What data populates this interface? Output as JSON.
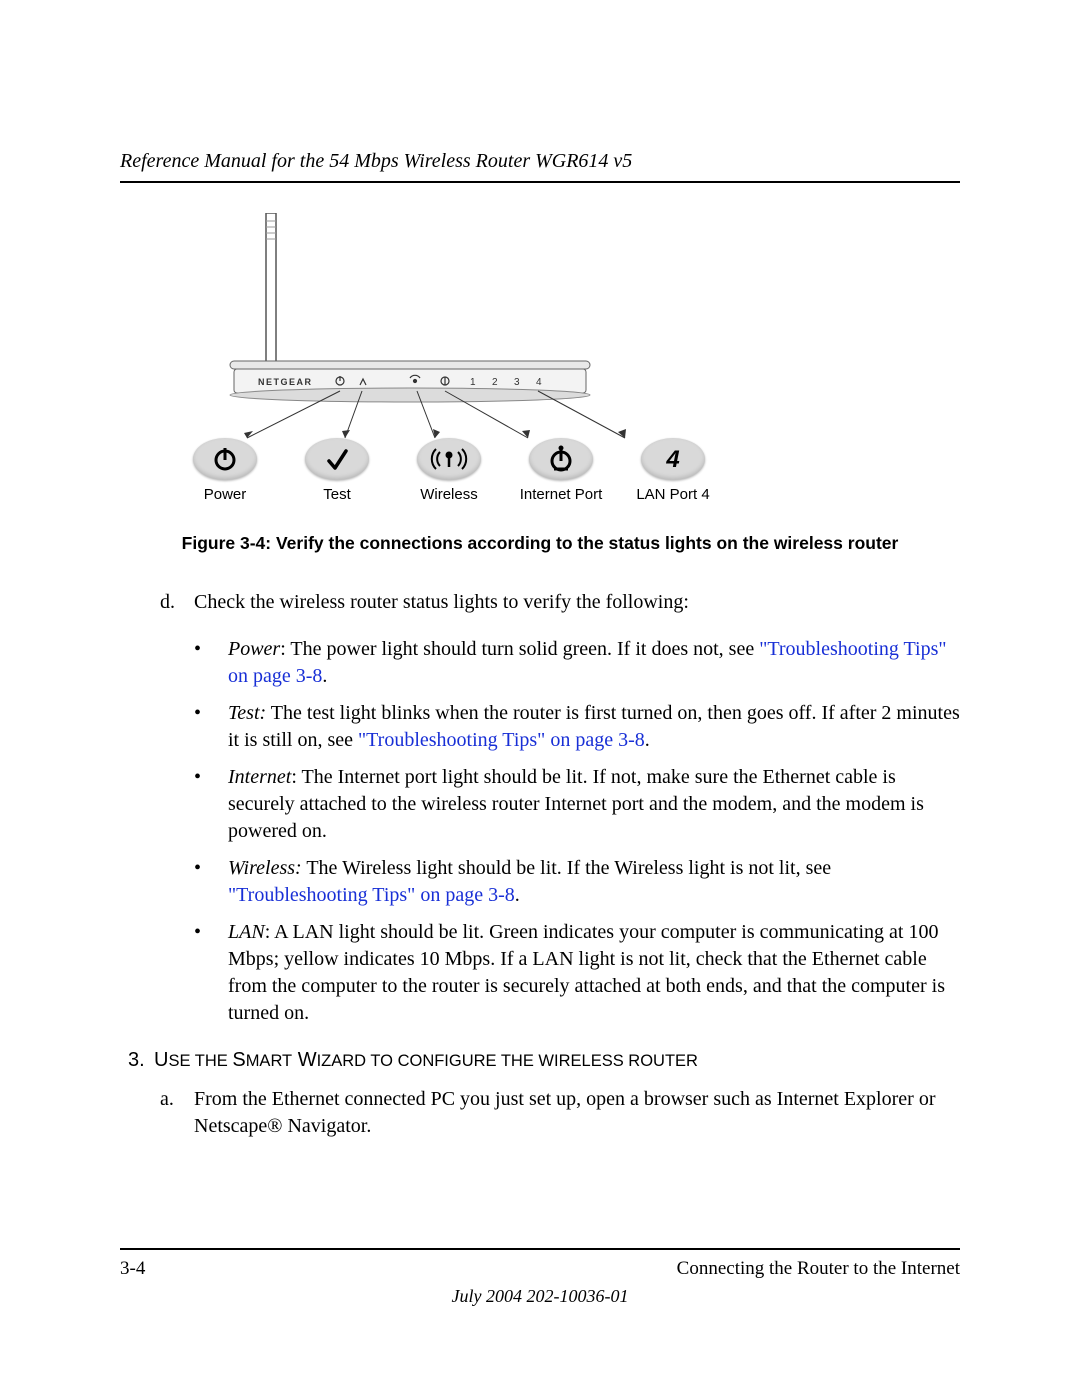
{
  "header": {
    "running_title": "Reference Manual for the 54 Mbps Wireless Router WGR614 v5"
  },
  "figure": {
    "brand": "NETGEAR",
    "panel_numbers": [
      "1",
      "2",
      "3",
      "4"
    ],
    "callouts": [
      {
        "name": "power-icon",
        "label": "Power"
      },
      {
        "name": "test-icon",
        "label": "Test"
      },
      {
        "name": "wireless-icon",
        "label": "Wireless"
      },
      {
        "name": "internet-icon",
        "label": "Internet Port"
      },
      {
        "name": "lan4-icon",
        "label": "LAN Port 4"
      }
    ],
    "caption": "Figure 3-4:  Verify the connections according to the status lights on the wireless router"
  },
  "list_d": {
    "marker": "d.",
    "intro": "Check the wireless router status lights to verify the following:",
    "bullets": [
      {
        "bold": "Power",
        "bold_italic": true,
        "text_before_link": ": The power light should turn solid green. If it does not, see ",
        "link": "\"Troubleshooting Tips\" on page 3-8",
        "text_after_link": "."
      },
      {
        "bold": "Test:",
        "bold_italic": true,
        "text_before_link": " The test light blinks when the router is first turned on, then goes off. If after 2 minutes it is still on, see ",
        "link": "\"Troubleshooting Tips\" on page 3-8",
        "text_after_link": "."
      },
      {
        "bold": "Internet",
        "bold_italic": true,
        "text_before_link": ": The Internet port light should be lit. If not, make sure the Ethernet cable is securely attached to the wireless router Internet port and the modem, and the modem is powered on.",
        "link": "",
        "text_after_link": ""
      },
      {
        "bold": "Wireless:",
        "bold_italic": true,
        "text_before_link": " The Wireless light should be lit. If the Wireless light is not lit, see ",
        "link": "\"Troubleshooting Tips\" on page 3-8",
        "text_after_link": "."
      },
      {
        "bold": "LAN",
        "bold_italic": true,
        "text_before_link": ": A LAN light should be lit. Green indicates your computer is communicating at 100 Mbps; yellow indicates 10 Mbps. If a LAN light is not lit, check that the Ethernet cable from the computer to the router is securely attached at both ends, and that the computer is turned on.",
        "link": "",
        "text_after_link": ""
      }
    ]
  },
  "section3": {
    "number": "3.",
    "word1_first": "U",
    "word1_rest": "SE",
    "middle": " THE ",
    "word2_first": "S",
    "word2_rest": "MART",
    "word3_first": " W",
    "word3_rest": "IZARD",
    "tail": " TO CONFIGURE THE WIRELESS ROUTER",
    "item_a_marker": "a.",
    "item_a_text": "From the Ethernet connected PC you just set up, open a browser such as Internet Explorer or Netscape® Navigator."
  },
  "footer": {
    "page_number": "3-4",
    "section_title": "Connecting the Router to the Internet",
    "date_doc": "July 2004 202-10036-01"
  }
}
